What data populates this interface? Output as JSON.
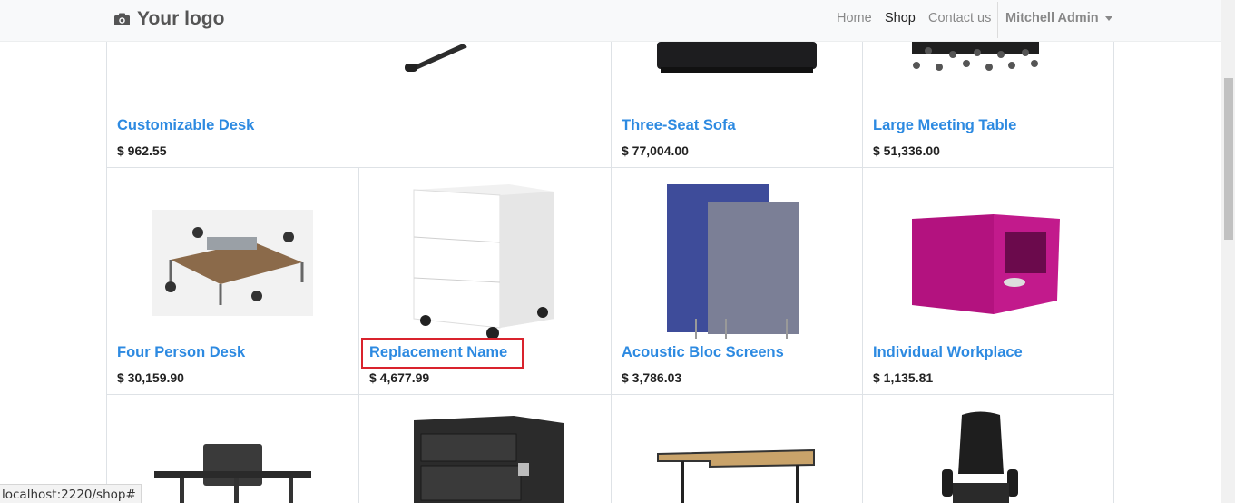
{
  "navbar": {
    "brand": "Your logo",
    "links": [
      {
        "label": "Home",
        "active": false
      },
      {
        "label": "Shop",
        "active": true
      },
      {
        "label": "Contact us",
        "active": false
      }
    ],
    "user": "Mitchell Admin"
  },
  "products": [
    {
      "name": "Customizable Desk",
      "price": "$ 962.55",
      "image": "desk-leg-image"
    },
    {
      "name": "Three-Seat Sofa",
      "price": "$ 77,004.00",
      "image": "sofa-image"
    },
    {
      "name": "Large Meeting Table",
      "price": "$ 51,336.00",
      "image": "meeting-table-image"
    },
    {
      "name": "Four Person Desk",
      "price": "$ 30,159.90",
      "image": "four-person-desk-image"
    },
    {
      "name": "Replacement Name",
      "price": "$ 4,677.99",
      "image": "drawer-cabinet-image"
    },
    {
      "name": "Acoustic Bloc Screens",
      "price": "$ 3,786.03",
      "image": "acoustic-screens-image"
    },
    {
      "name": "Individual Workplace",
      "price": "$ 1,135.81",
      "image": "workplace-pod-image"
    }
  ],
  "status_bar": {
    "url": "localhost:2220/shop#"
  },
  "colors": {
    "link": "#2d8ae1",
    "highlight": "#d9232d"
  }
}
